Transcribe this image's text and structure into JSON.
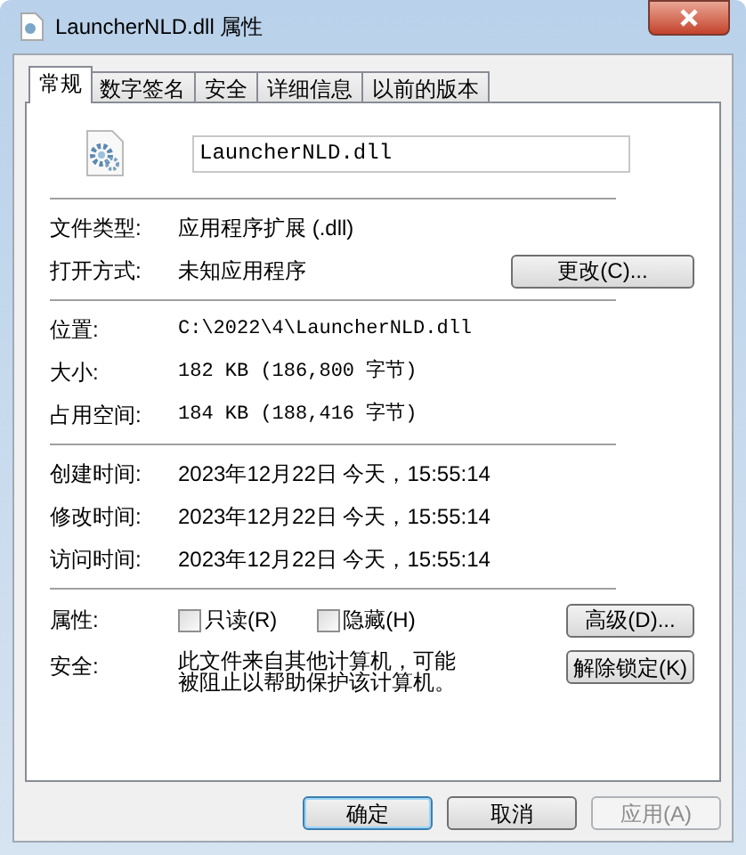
{
  "window": {
    "title": "LauncherNLD.dll 属性"
  },
  "tabs": [
    {
      "label": "常规",
      "selected": true
    },
    {
      "label": "数字签名",
      "selected": false
    },
    {
      "label": "安全",
      "selected": false
    },
    {
      "label": "详细信息",
      "selected": false
    },
    {
      "label": "以前的版本",
      "selected": false
    }
  ],
  "file_name": {
    "value": "LauncherNLD.dll"
  },
  "sections": [
    [
      {
        "label": "文件类型:",
        "value": "应用程序扩展 (.dll)"
      },
      {
        "label": "打开方式:",
        "value": "未知应用程序",
        "button": "更改(C)..."
      }
    ],
    [
      {
        "label": "位置:",
        "value": "C:\\2022\\4\\LauncherNLD.dll"
      },
      {
        "label": "大小:",
        "value": "182 KB (186,800 字节)"
      },
      {
        "label": "占用空间:",
        "value": "184 KB (188,416 字节)"
      }
    ],
    [
      {
        "label": "创建时间:",
        "value": "2023年12月22日 今天，15:55:14"
      },
      {
        "label": "修改时间:",
        "value": "2023年12月22日 今天，15:55:14"
      },
      {
        "label": "访问时间:",
        "value": "2023年12月22日 今天，15:55:14"
      }
    ]
  ],
  "attributes": {
    "label": "属性:",
    "checkboxes": [
      {
        "label": "只读(R)",
        "checked": false
      },
      {
        "label": "隐藏(H)",
        "checked": false
      }
    ],
    "button": "高级(D)..."
  },
  "security": {
    "label": "安全:",
    "text": "此文件来自其他计算机，可能被阻止以帮助保护该计算机。",
    "button": "解除锁定(K)"
  },
  "buttons": [
    {
      "label": "确定",
      "default": true,
      "disabled": false
    },
    {
      "label": "取消",
      "default": false,
      "disabled": false
    },
    {
      "label": "应用(A)",
      "default": false,
      "disabled": true
    }
  ]
}
